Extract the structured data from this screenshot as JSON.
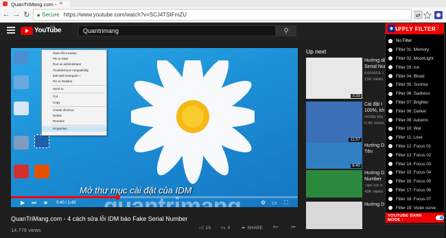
{
  "browser": {
    "tab_title": "QuanTriMang.com - ",
    "secure_label": "Secure",
    "url": "https://www.youtube.com/watch?v=SCJ4TSIFmZU"
  },
  "youtube": {
    "country": "VN",
    "search_value": "Quantrimang",
    "logo_text": "YouTube"
  },
  "video": {
    "subtitle": "Mở thư mục cài đặt của IDM",
    "watermark": "quantrimang",
    "time": "0:40 / 1:49",
    "progress": 0.37,
    "context_menu": [
      "Open file location",
      "Pin to Start",
      "Run as administrator",
      "Troubleshoot compatibility",
      "Edit with Notepad++",
      "Pin to Taskbar",
      "-",
      "Send to",
      "-",
      "Cut",
      "Copy",
      "-",
      "Create shortcut",
      "Delete",
      "Rename",
      "-",
      "Properties"
    ],
    "title": "QuanTriMang.com - 4 cách sửa lỗi IDM báo Fake Serial Number",
    "views": "14,776 views",
    "likes": "19",
    "dislikes": "4",
    "share_label": "SHARE"
  },
  "upnext": {
    "label": "Up next",
    "items": [
      {
        "title1": "Hướng dẫ",
        "title2": "Serial Num",
        "channel": "Konosha T",
        "views": "15K views",
        "duration": "3:33",
        "color": "#e8e8e8"
      },
      {
        "title1": "Cài đặt I",
        "title2": "100%, kh",
        "channel": "Anhdv Blo",
        "views": "9.9K views",
        "duration": "11:57",
        "color": "#3b6fb6"
      },
      {
        "title1": "Hướng D",
        "title2": "Tên",
        "channel": "",
        "views": "",
        "duration": "6:40",
        "color": "#2f7fc1"
      },
      {
        "title1": "Hướng D",
        "title2": "Number",
        "channel": "Tiện ích V",
        "views": "49K views",
        "duration": "",
        "color": "#2b8a3e"
      },
      {
        "title1": "Hướng D",
        "title2": "",
        "channel": "",
        "views": "",
        "duration": "",
        "color": "#d9d9d9"
      }
    ]
  },
  "filter_panel": {
    "header": "APPLY FILTER",
    "options": [
      "No Filter",
      "Filter 01: Memory",
      "Filter 02: MoonLight",
      "Filter 03: Ice",
      "Filter 04: Blood",
      "Filter 05: Sunrise",
      "Filter 06: Sadness",
      "Filter 07: Brighter",
      "Filter 08: Darker",
      "Filter 09: Autumn",
      "Filter 10: War",
      "Filter 11: Love",
      "Filter 12: Focus 01",
      "Filter 13: Focus 02",
      "Filter 14: Focus 03",
      "Filter 15: Focus 04",
      "Filter 16: Focus 05",
      "Filter 17: Focus 06",
      "Filter 18: Focus 07",
      "Filter 19: Violet curve"
    ],
    "selected": "No Filter",
    "dark_mode_label": "YOUTUBE DARK MODE :"
  },
  "colors": {
    "accent": "#e00000",
    "bg": "#1e1e1e"
  }
}
